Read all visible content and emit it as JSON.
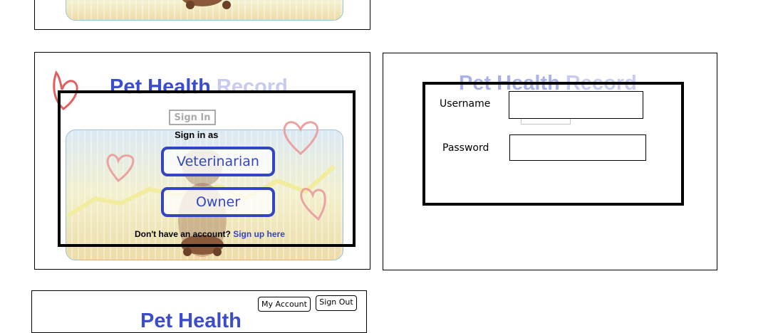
{
  "signin_mockup": {
    "title": "Pet Health",
    "title_tail": " Record",
    "sign_in_button": "Sign In",
    "sign_in_as": "Sign in as",
    "roles": [
      "Veterinarian",
      "Owner"
    ],
    "no_account_text": "Don't have an account?",
    "signup_link": "Sign up here"
  },
  "login_mockup": {
    "title": "Pet Health",
    "title_tail": " Record",
    "username_label": "Username",
    "password_label": "Password"
  },
  "home_mockup": {
    "title": "Pet Health",
    "my_account_button": "My Account",
    "sign_out_button": "Sign Out"
  },
  "colors": {
    "brand_blue": "#3346c0",
    "faded_title": "#c7ccef",
    "heart_red": "#e06060"
  }
}
